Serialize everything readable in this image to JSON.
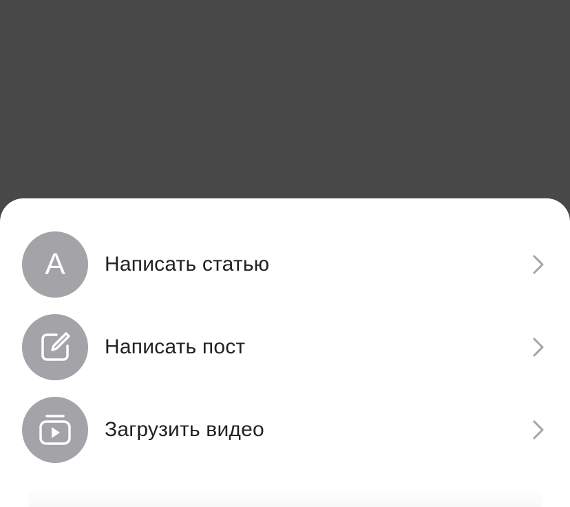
{
  "colors": {
    "backdrop": "#484848",
    "sheet": "#ffffff",
    "icon_circle": "#a3a3a8",
    "label_text": "#222222",
    "chevron": "#a3a3a8"
  },
  "menu": {
    "items": [
      {
        "label": "Написать статью",
        "icon": "letter-a-icon",
        "icon_text": "A"
      },
      {
        "label": "Написать пост",
        "icon": "edit-post-icon"
      },
      {
        "label": "Загрузить видео",
        "icon": "video-upload-icon"
      }
    ]
  }
}
